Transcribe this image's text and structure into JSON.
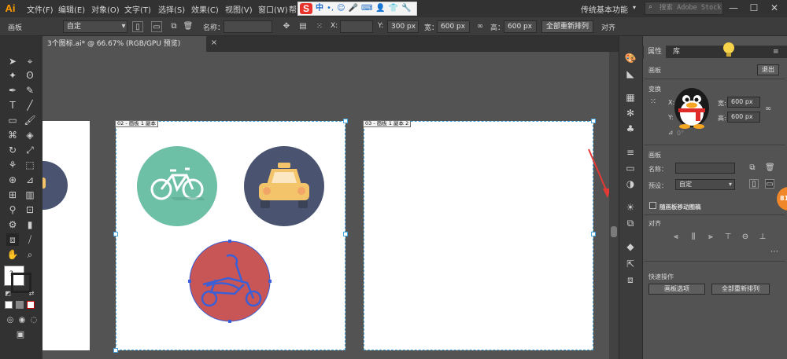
{
  "menubar": {
    "app": "Ai",
    "items": [
      "文件(F)",
      "编辑(E)",
      "对象(O)",
      "文字(T)",
      "选择(S)",
      "效果(C)",
      "视图(V)",
      "窗口(W)",
      "帮"
    ],
    "ime": {
      "logo": "S",
      "mode": "中",
      "punct": "•,",
      "emoji": "☺",
      "mic": "🎤",
      "keyboard": "⌨",
      "user": "👤",
      "shirt": "👕",
      "tool": "🔧"
    },
    "workspace": "传统基本功能",
    "stock_search_placeholder": "搜索 Adobe Stock",
    "win_min": "—",
    "win_max": "☐",
    "win_close": "✕"
  },
  "controlbar": {
    "label": "画板",
    "preset": "自定",
    "name_label": "名称：",
    "x_label": "X:",
    "y_label": "Y:",
    "y_value": "300 px",
    "w_label": "宽：",
    "w_value": "600 px",
    "h_label": "高：",
    "h_value": "600 px",
    "rearrange_all": "全部重新排列",
    "align": "对齐"
  },
  "document": {
    "tab_title": "3个图标.ai* @ 66.67% (RGB/GPU 预览)",
    "tab_close": "×"
  },
  "artboards": [
    {
      "label": "02 - 画板 1 副本"
    },
    {
      "label": "03 - 画板 1 副本 2"
    }
  ],
  "icons_art": {
    "bike_color": "#6dbfa6",
    "taxi_color": "#4a5470",
    "moto_color": "#c95656",
    "selection_color": "#3a5fd6",
    "artboard_border": "#4aa8e0"
  },
  "properties": {
    "tab_props": "属性",
    "tab_lib": "库",
    "section_artboard": "画板",
    "exit_btn": "退出",
    "section_transform": "变换",
    "x_label": "X:",
    "y_label": "Y:",
    "w_value": "600 px",
    "h_value": "600 px",
    "angle_value": "0°",
    "section_artboard2": "画板",
    "name_label": "名称：",
    "preset_label": "预设：",
    "preset_value": "自定",
    "move_with_artboard": "随画板移动图稿",
    "section_align": "对齐",
    "section_quick": "快速操作",
    "artboard_options_btn": "画板选项",
    "rearrange_all_btn": "全部重新排列",
    "badge": "81"
  }
}
